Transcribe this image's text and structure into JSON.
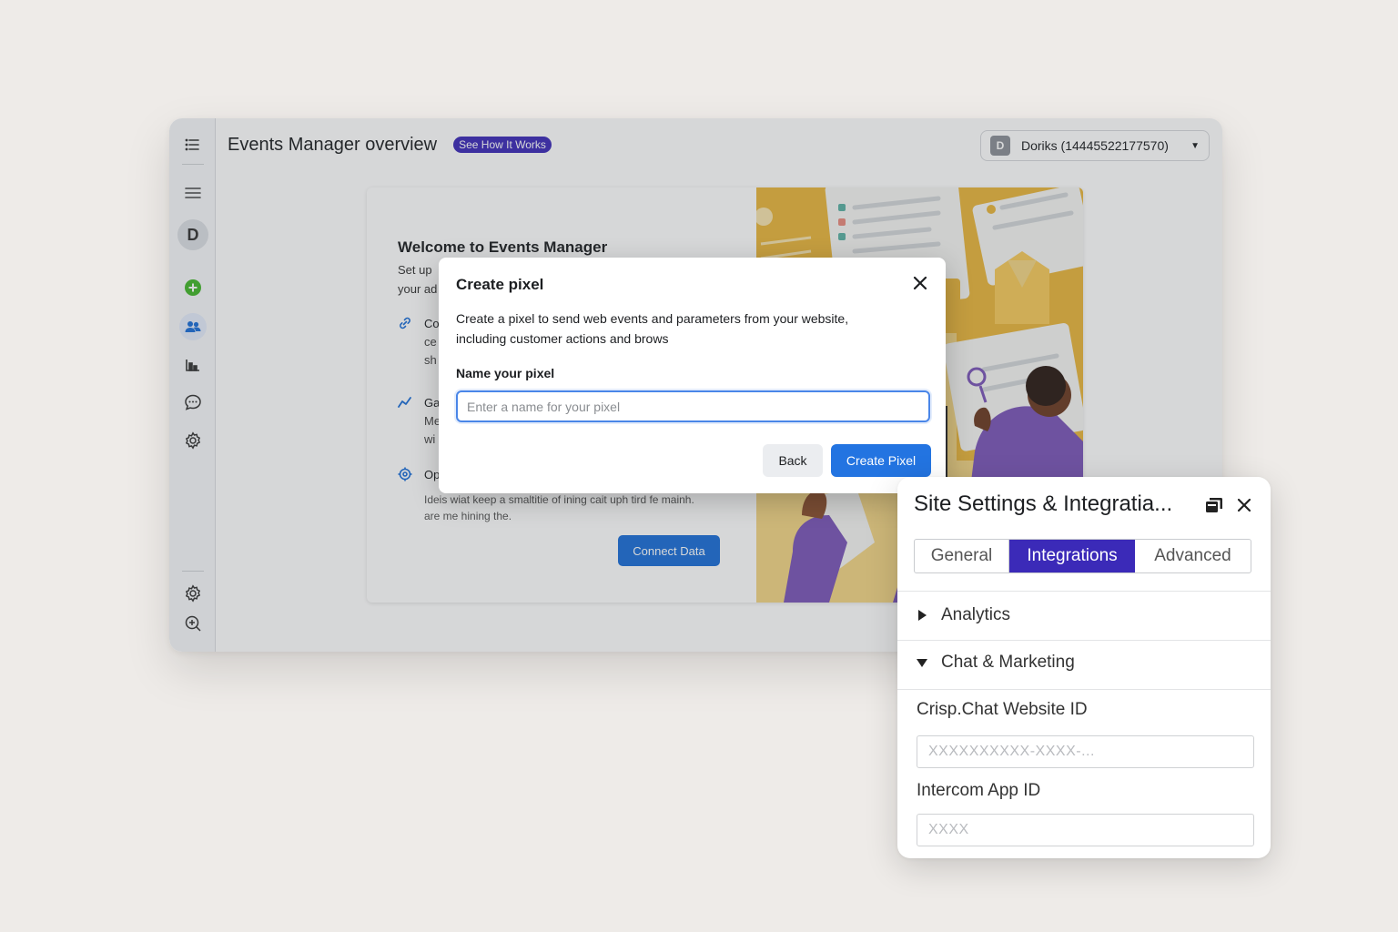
{
  "app": {
    "title": "Events Manager overview",
    "see_how_badge": "See How It Works",
    "account": {
      "initial": "D",
      "name": "Doriks (14445522177570)"
    },
    "sidebar": {
      "avatar_initial": "D",
      "items": [
        {
          "name": "menu-icon"
        },
        {
          "name": "add-icon",
          "color": "#42b72a"
        },
        {
          "name": "people-icon",
          "active": true
        },
        {
          "name": "chart-icon"
        },
        {
          "name": "chat-icon"
        },
        {
          "name": "gear-icon"
        },
        {
          "name": "settings-icon"
        },
        {
          "name": "search-zoom-icon"
        }
      ]
    },
    "welcome": {
      "title": "Welcome to Events Manager",
      "subtitle_line1": "Set up",
      "subtitle_line2": "your ad",
      "features": [
        {
          "icon": "link-icon",
          "head": "Co",
          "line2": "ce",
          "line3": "sh"
        },
        {
          "icon": "graph-icon",
          "head": "Ga",
          "line2": "Me",
          "line3": "wi"
        },
        {
          "icon": "target-icon",
          "head": "Op",
          "line2": ""
        }
      ],
      "feature_note_line1": "Ideis wiat keep a smaltitie of ining cait uph tird fe mainh.",
      "feature_note_line2": "are me hining the.",
      "connect_button": "Connect Data"
    }
  },
  "modal": {
    "title": "Create pixel",
    "description": "Create a pixel to send web events and parameters from your website, including customer actions and brows",
    "field_label": "Name your pixel",
    "field_value": "",
    "field_placeholder": "Enter a name for your pixel",
    "back_button": "Back",
    "create_button": "Create Pixel"
  },
  "settings_panel": {
    "title": "Site Settings & Integratia...",
    "tabs": [
      {
        "label": "General",
        "active": false
      },
      {
        "label": "Integrations",
        "active": true
      },
      {
        "label": "Advanced",
        "active": false
      }
    ],
    "sections": [
      {
        "label": "Analytics",
        "expanded": false
      },
      {
        "label": "Chat & Marketing",
        "expanded": true
      }
    ],
    "fields": [
      {
        "label": "Crisp.Chat Website ID",
        "value": "",
        "placeholder": "XXXXXXXXXX-XXXX-..."
      },
      {
        "label": "Intercom App ID",
        "value": "",
        "placeholder": "XXXX"
      }
    ]
  },
  "colors": {
    "accent_purple": "#3b2ab8",
    "primary_blue": "#2374e1",
    "illustration_yellow": "#e8b53c",
    "illustration_purple": "#7a55b8"
  }
}
